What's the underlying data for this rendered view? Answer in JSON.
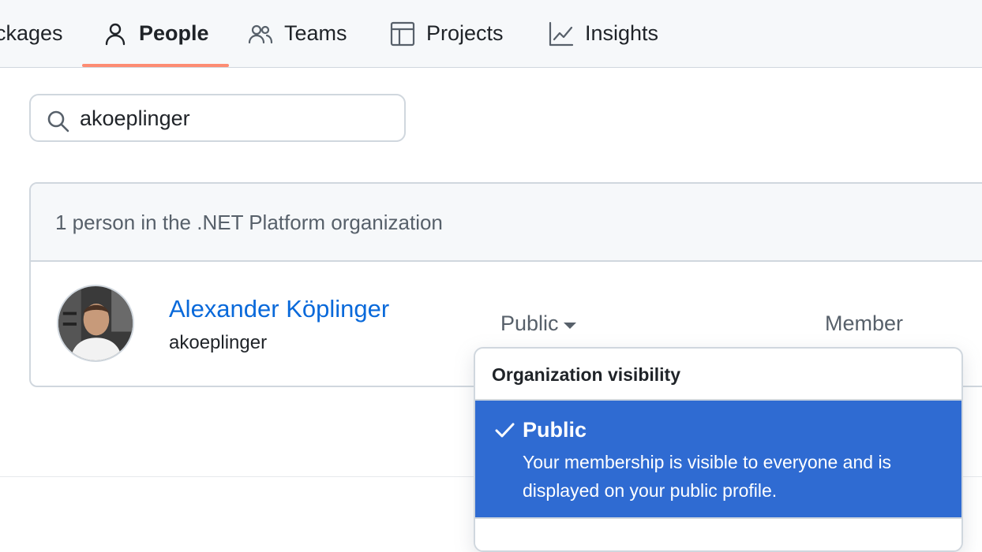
{
  "nav": {
    "tabs": [
      {
        "label": "ckages",
        "icon": "package-icon"
      },
      {
        "label": "People",
        "icon": "person-icon"
      },
      {
        "label": "Teams",
        "icon": "people-icon"
      },
      {
        "label": "Projects",
        "icon": "table-icon"
      },
      {
        "label": "Insights",
        "icon": "graph-icon"
      }
    ],
    "active_tab": "People",
    "active_color": "#fd8c73"
  },
  "search": {
    "value": "akoeplinger",
    "icon": "search-icon"
  },
  "members": {
    "summary": "1 person in the .NET Platform organization",
    "rows": [
      {
        "name": "Alexander Köplinger",
        "login": "akoeplinger",
        "visibility": "Public",
        "role": "Member"
      }
    ]
  },
  "visibility_menu": {
    "header": "Organization visibility",
    "options": [
      {
        "title": "Public",
        "description": "Your membership is visible to everyone and is displayed on your public profile.",
        "selected": true
      }
    ],
    "selected_color": "#2f6bd2"
  },
  "colors": {
    "link": "#0969da",
    "muted": "#57606a",
    "border": "#d0d7de"
  }
}
